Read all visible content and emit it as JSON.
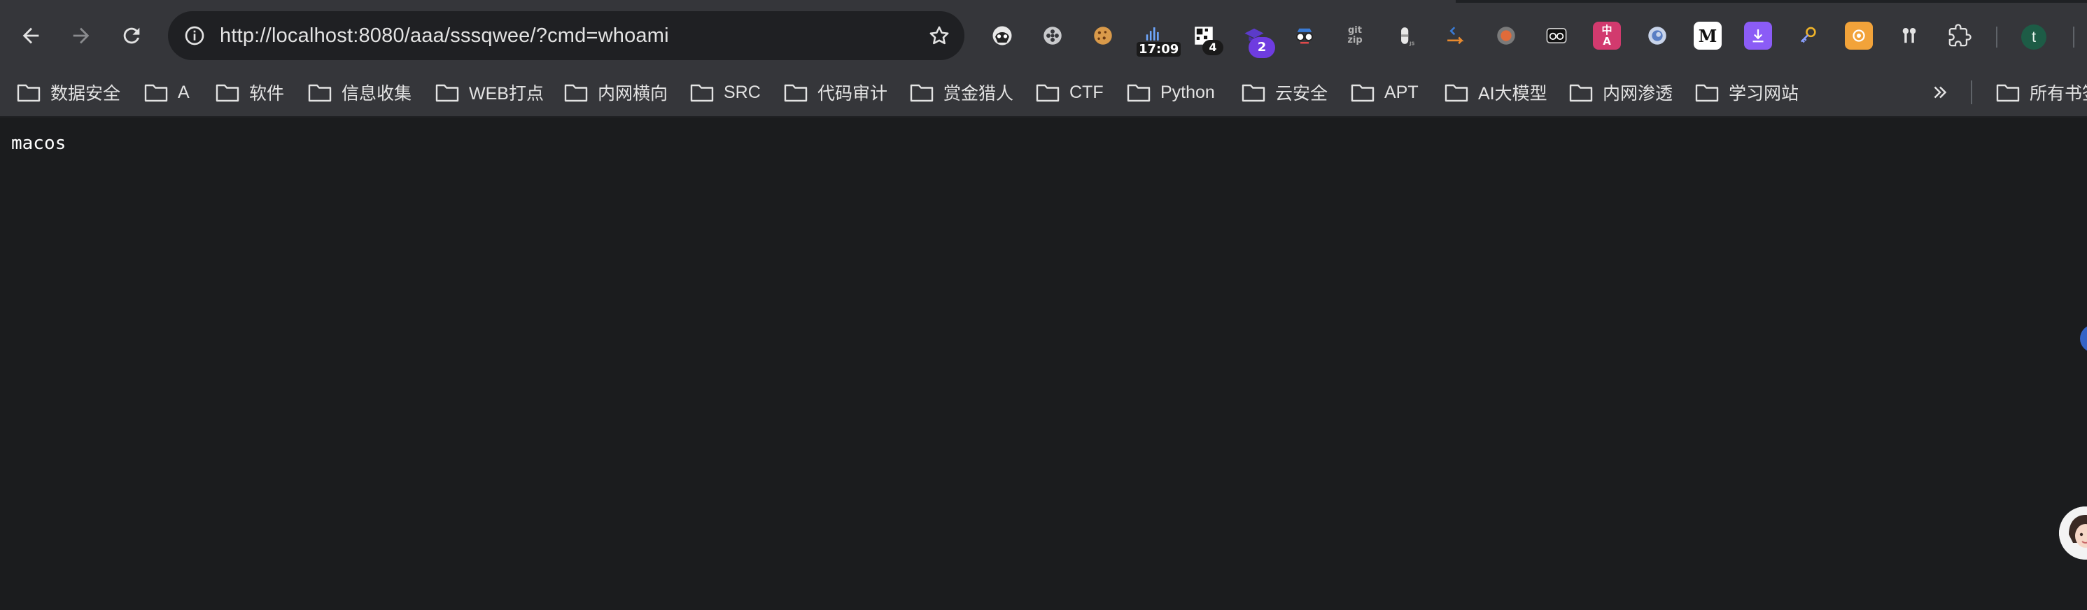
{
  "address_bar": {
    "url": "http://localhost:8080/aaa/sssqwee/?cmd=whoami"
  },
  "navigation": {
    "back_icon": "back-arrow-icon",
    "forward_icon": "forward-arrow-icon",
    "reload_icon": "reload-icon"
  },
  "extensions": [
    {
      "icon": "hacker-face-icon"
    },
    {
      "icon": "flower-icon"
    },
    {
      "icon": "cookie-icon"
    },
    {
      "icon": "signal-clock-icon",
      "badge": "17:09"
    },
    {
      "icon": "qr-code-icon",
      "badge": "4"
    },
    {
      "icon": "graduation-cap-icon",
      "badge": "2"
    },
    {
      "icon": "spy-glasses-icon"
    },
    {
      "icon": "git-zip-icon",
      "text": "git zip"
    },
    {
      "icon": "js-bottle-icon"
    },
    {
      "icon": "orange-arrow-icon"
    },
    {
      "icon": "orange-circle-icon"
    },
    {
      "icon": "glasses-icon"
    },
    {
      "icon": "translate-icon",
      "text": "中 A"
    },
    {
      "icon": "blue-ring-icon"
    },
    {
      "icon": "medium-icon",
      "text": "M"
    },
    {
      "icon": "download-icon"
    },
    {
      "icon": "key-icon"
    },
    {
      "icon": "orange-box-icon"
    },
    {
      "icon": "password-keys-icon"
    },
    {
      "icon": "puzzle-icon"
    }
  ],
  "profile": {
    "initial": "t"
  },
  "bookmarks": [
    {
      "label": "数据安全"
    },
    {
      "label": "A"
    },
    {
      "label": "软件"
    },
    {
      "label": "信息收集"
    },
    {
      "label": "WEB打点"
    },
    {
      "label": "内网横向"
    },
    {
      "label": "SRC"
    },
    {
      "label": "代码审计"
    },
    {
      "label": "赏金猎人"
    },
    {
      "label": "CTF"
    },
    {
      "label": "Python"
    },
    {
      "label": "云安全"
    },
    {
      "label": "APT"
    },
    {
      "label": "AI大模型"
    },
    {
      "label": "内网渗透"
    },
    {
      "label": "学习网站"
    }
  ],
  "other_bookmarks": {
    "label": "所有书签"
  },
  "page": {
    "output": "macos"
  },
  "colors": {
    "toolbar": "#35363a",
    "omnibox": "#1f2023",
    "page_background": "#1b1c1e",
    "text": "#e3e3e3"
  }
}
